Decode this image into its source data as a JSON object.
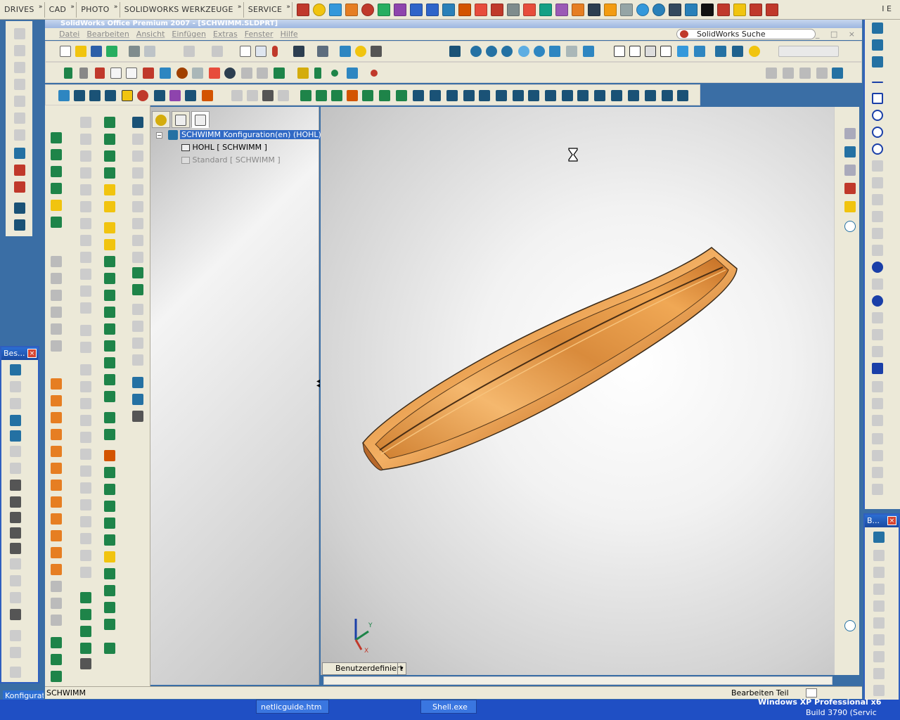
{
  "launcher": {
    "menus": [
      "DRIVES",
      "CAD",
      "PHOTO",
      "SOLIDWORKS WERKZEUGE",
      "SERVICE"
    ],
    "ie_label": "I E"
  },
  "window": {
    "title": "SolidWorks Office Premium 2007 - [SCHWIMM.SLDPRT]"
  },
  "menubar": {
    "items": [
      "Datei",
      "Bearbeiten",
      "Ansicht",
      "Einfügen",
      "Extras",
      "Fenster",
      "Hilfe"
    ]
  },
  "search": {
    "label": "SolidWorks Suche"
  },
  "feature_manager": {
    "root_label": "SCHWIMM Konfiguration(en)  (HOHL)",
    "configs": [
      "HOHL [ SCHWIMM ]",
      "Standard [ SCHWIMM ]"
    ]
  },
  "viewport": {
    "view_dropdown": "Benutzerdefiniert",
    "axis_labels": [
      "Y",
      "X"
    ]
  },
  "status": {
    "left": "SCHWIMM",
    "right": "Bearbeiten Teil"
  },
  "left_panel": {
    "title": "Bes...",
    "bottom_label": "Konfigurati"
  },
  "right_panel": {
    "title": "B..."
  },
  "taskbar": {
    "items": [
      "netlicguide.htm",
      "Shell.exe"
    ],
    "os_text": "Windows XP Professional x6",
    "build_text": "Build 3790 (Servic"
  }
}
